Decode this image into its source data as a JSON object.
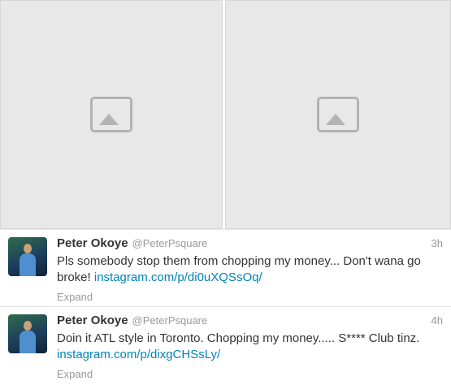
{
  "tweets": [
    {
      "name": "Peter Okoye",
      "handle": "@PeterPsquare",
      "time": "3h",
      "text": "Pls somebody stop them from chopping my money... Don't wana go broke! ",
      "link": "instagram.com/p/di0uXQSsOq/",
      "expand": "Expand"
    },
    {
      "name": "Peter Okoye",
      "handle": "@PeterPsquare",
      "time": "4h",
      "text": "Doin it ATL style in Toronto. Chopping my money..... S**** Club tinz. ",
      "link": "instagram.com/p/dixgCHSsLy/",
      "expand": "Expand"
    }
  ]
}
